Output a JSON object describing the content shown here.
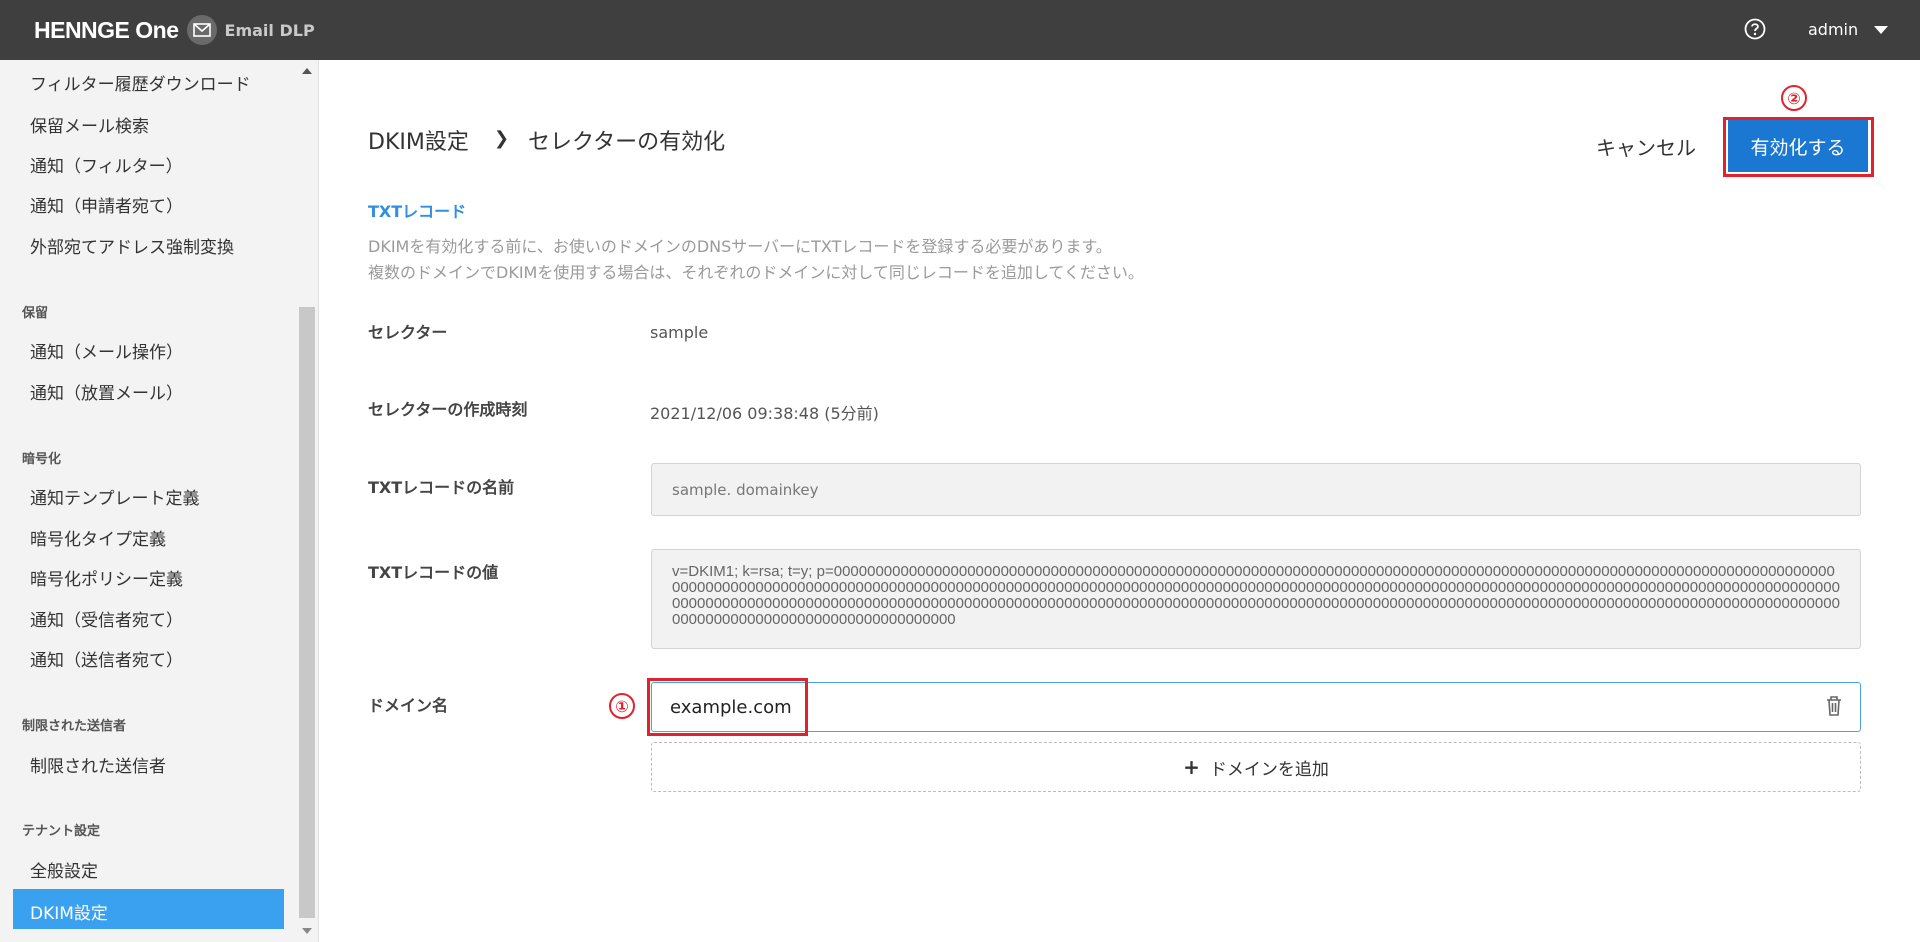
{
  "header": {
    "brand_name": "HENNGE One",
    "product": "Email DLP",
    "help_icon": "help-icon",
    "user": "admin"
  },
  "sidebar": {
    "items_top": [
      {
        "label": "フィルター履歴ダウンロード"
      },
      {
        "label": "保留メール検索"
      },
      {
        "label": "通知（フィルター）"
      },
      {
        "label": "通知（申請者宛て）"
      },
      {
        "label": "外部宛てアドレス強制変換"
      }
    ],
    "sections": [
      {
        "title": "保留",
        "items": [
          "通知（メール操作）",
          "通知（放置メール）"
        ]
      },
      {
        "title": "暗号化",
        "items": [
          "通知テンプレート定義",
          "暗号化タイプ定義",
          "暗号化ポリシー定義",
          "通知（受信者宛て）",
          "通知（送信者宛て）"
        ]
      },
      {
        "title": "制限された送信者",
        "items": [
          "制限された送信者"
        ]
      },
      {
        "title": "テナント設定",
        "items": [
          "全般設定",
          "DKIM設定"
        ]
      }
    ],
    "active": "DKIM設定"
  },
  "breadcrumb": {
    "parent": "DKIM設定",
    "separator": "❯",
    "current": "セレクターの有効化"
  },
  "actions": {
    "cancel": "キャンセル",
    "enable": "有効化する"
  },
  "markers": {
    "one": "①",
    "two": "②"
  },
  "txt_section": {
    "title": "TXTレコード",
    "desc1": "DKIMを有効化する前に、お使いのドメインのDNSサーバーにTXTレコードを登録する必要があります。",
    "desc2": "複数のドメインでDKIMを使用する場合は、それぞれのドメインに対して同じレコードを追加してください。"
  },
  "fields": {
    "selector_label": "セレクター",
    "selector_value": "sample",
    "created_label": "セレクターの作成時刻",
    "created_value": "2021/12/06 09:38:48 (5分前)",
    "txt_name_label": "TXTレコードの名前",
    "txt_name_value": "sample. domainkey",
    "txt_value_label": "TXTレコードの値",
    "txt_value": "v=DKIM1; k=rsa; t=y; p=00000000000000000000000000000000000000000000000000000000000000000000000000000000000000000000000000000000000000000000000000000000000000000000000000000000000000000000000000000000000000000000000000000000000000000000000000000000000000000000000000000000000000000000000000000000000000000000000000000000000000000000000000000000000000000000000000000000000000000000000000000000000000000000000000000000000000000000000000000000000000000000000000",
    "domain_label": "ドメイン名",
    "domain_value": "example.com",
    "add_domain": "ドメインを追加"
  },
  "colors": {
    "topbar": "#3f3f3f",
    "primary": "#1a77d2",
    "active_nav": "#3aa0f0",
    "annotation": "#e0222c"
  }
}
